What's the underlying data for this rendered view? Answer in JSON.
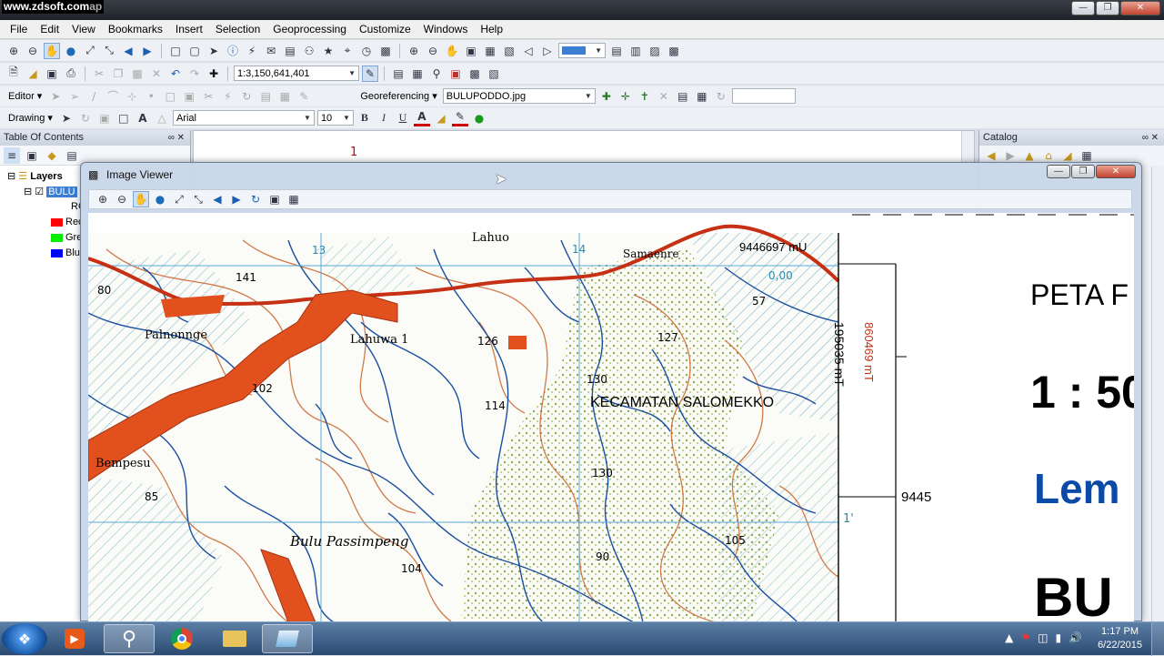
{
  "watermark": "www.zdsoft.com",
  "app_title_fragment": "ap",
  "menu": [
    "File",
    "Edit",
    "View",
    "Bookmarks",
    "Insert",
    "Selection",
    "Geoprocessing",
    "Customize",
    "Windows",
    "Help"
  ],
  "toolbar": {
    "scale": "1:3,150,641,401",
    "editor_label": "Editor",
    "georef_label": "Georeferencing",
    "georef_layer": "BULUPODDO.jpg",
    "drawing_label": "Drawing",
    "font_name": "Arial",
    "font_size": "10",
    "bold": "B",
    "italic": "I",
    "underline": "U"
  },
  "toc": {
    "title": "Table Of Contents",
    "layers_label": "Layers",
    "layer_name": "BULU",
    "sub_label": "RG",
    "bands": [
      {
        "label": "Rec",
        "color": "#ff0000"
      },
      {
        "label": "Gre",
        "color": "#00ee00"
      },
      {
        "label": "Blu",
        "color": "#0000ff"
      }
    ]
  },
  "catalog": {
    "title": "Catalog"
  },
  "viewer": {
    "title": "Image Viewer",
    "map": {
      "places": [
        "Lahuo",
        "Samaenre",
        "Palnonnge",
        "Lahuwa 1",
        "Bempesu",
        "Bulu Passimpeng",
        "KECAMATAN  SALOMEKKO"
      ],
      "heights": [
        "141",
        "80",
        "126",
        "102",
        "114",
        "130",
        "130",
        "127",
        "57",
        "85",
        "104",
        "105",
        "90",
        "13",
        "14"
      ],
      "coords": [
        "9446697 mU",
        "195035 mT",
        "860469 mT",
        "9445",
        "1'",
        "0,00"
      ],
      "legend_fragments": [
        "PETA F",
        "1 : 50",
        "Lem",
        "BU"
      ]
    }
  },
  "taskbar": {
    "time": "1:17 PM",
    "date": "6/22/2015"
  },
  "colors": {
    "road": "#e2501e",
    "river": "#1a4fa0",
    "contour": "#c8642a",
    "hatch": "#2a8ab0",
    "forest": "#7a9a3a",
    "legend_blue": "#0b4aa8"
  }
}
